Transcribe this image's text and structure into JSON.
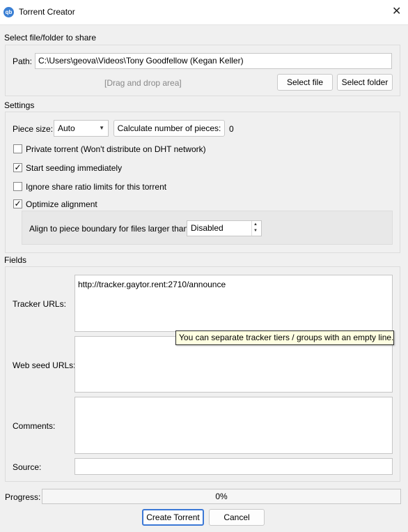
{
  "window": {
    "title": "Torrent Creator",
    "app_icon_text": "qb",
    "close_glyph": "✕"
  },
  "share": {
    "section_label": "Select file/folder to share",
    "path_label": "Path:",
    "path_value": "C:\\Users\\geova\\Videos\\Tony Goodfellow (Kegan Keller)",
    "drop_area": "[Drag and drop area]",
    "select_file": "Select file",
    "select_folder": "Select folder"
  },
  "settings": {
    "section_label": "Settings",
    "piece_size_label": "Piece size:",
    "piece_size_value": "Auto",
    "calculate_button": "Calculate number of pieces:",
    "pieces_count": "0",
    "private_torrent": {
      "label": "Private torrent (Won't distribute on DHT network)",
      "checked": false
    },
    "start_seeding": {
      "label": "Start seeding immediately",
      "checked": true
    },
    "ignore_share_ratio": {
      "label": "Ignore share ratio limits for this torrent",
      "checked": false
    },
    "optimize_alignment": {
      "label": "Optimize alignment",
      "checked": true
    },
    "align_label": "Align to piece boundary for files larger than:",
    "align_value": "Disabled",
    "check_glyph": "✓"
  },
  "fields": {
    "section_label": "Fields",
    "tracker_urls_label": "Tracker URLs:",
    "tracker_urls_value": "http://tracker.gaytor.rent:2710/announce",
    "web_seed_label": "Web seed URLs:",
    "web_seed_value": "",
    "comments_label": "Comments:",
    "comments_value": "",
    "source_label": "Source:",
    "source_value": "",
    "tooltip": "You can separate tracker tiers / groups with an empty line."
  },
  "progress": {
    "label": "Progress:",
    "value_text": "0%",
    "value": 0
  },
  "buttons": {
    "create": "Create Torrent",
    "cancel": "Cancel"
  }
}
